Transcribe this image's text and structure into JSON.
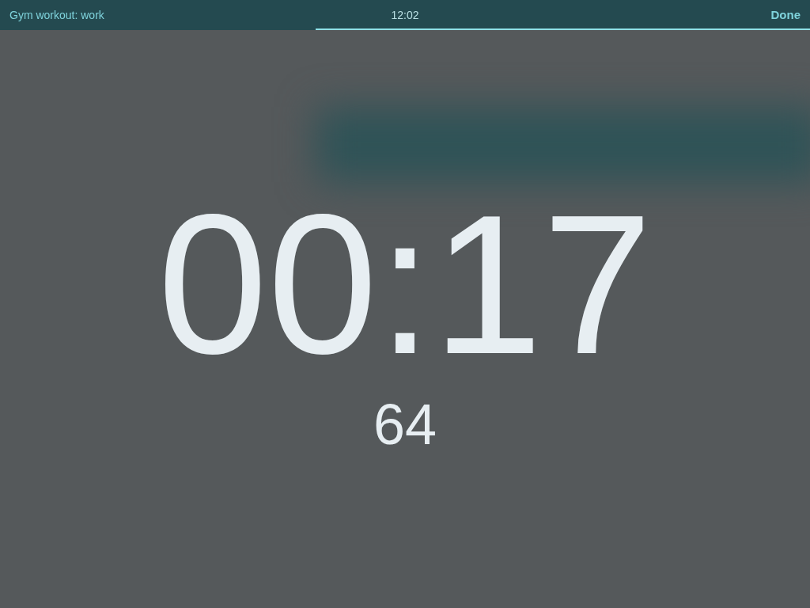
{
  "status_bar": {
    "title": "Gym workout: work",
    "time": "12:02",
    "done": "Done"
  },
  "progress": {
    "level": 0.61
  },
  "timer": {
    "time": "00:17",
    "count": "64"
  }
}
